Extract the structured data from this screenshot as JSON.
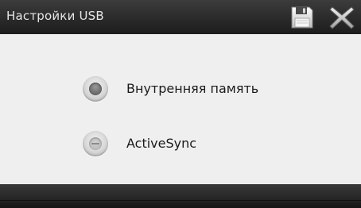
{
  "window": {
    "title": "Настройки USB"
  },
  "toolbar": {
    "save_icon": "floppy-disk-icon",
    "close_icon": "close-x-icon"
  },
  "usb_mode": {
    "options": [
      {
        "label": "Внутренняя память",
        "selected": true
      },
      {
        "label": "ActiveSync",
        "selected": false
      }
    ]
  },
  "colors": {
    "titlebar": "#2a2a2a",
    "content_background": "#efefef",
    "text": "#1a1a1a"
  }
}
